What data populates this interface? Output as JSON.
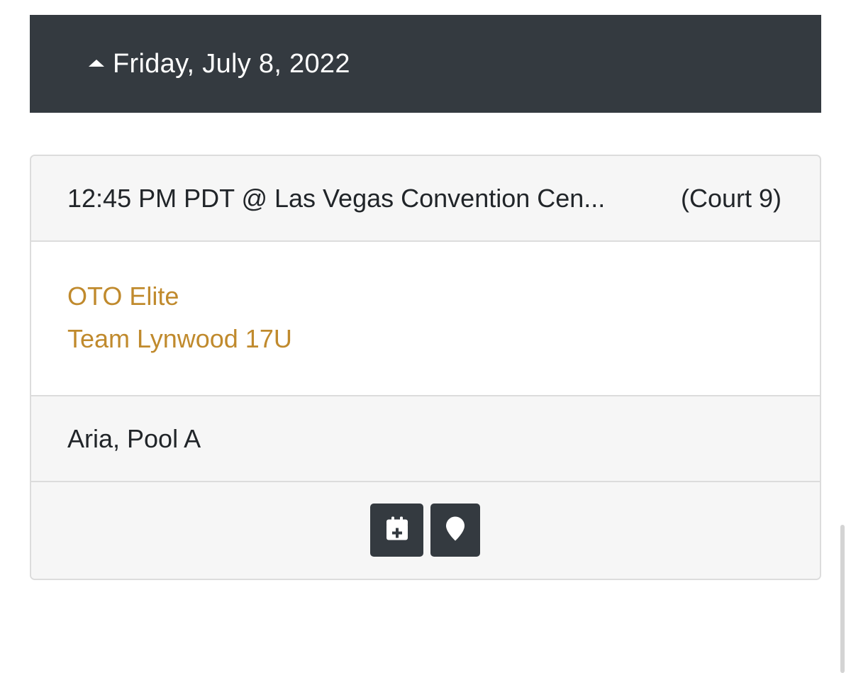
{
  "schedule": {
    "date_label": "Friday, July 8, 2022",
    "expand_icon": "caret-up-icon"
  },
  "game": {
    "time_location": "12:45 PM PDT @ Las Vegas Convention Cen...",
    "court": "(Court 9)",
    "teams": [
      "OTO Elite",
      "Team Lynwood 17U"
    ],
    "pool": "Aria, Pool A",
    "actions": {
      "calendar_icon": "calendar-plus-icon",
      "map_icon": "map-marker-icon"
    }
  },
  "colors": {
    "header_bg": "#343a40",
    "team_link": "#c08a2d",
    "row_bg": "#f6f6f6",
    "border": "#dcdcdc",
    "button_bg": "#343a40"
  }
}
